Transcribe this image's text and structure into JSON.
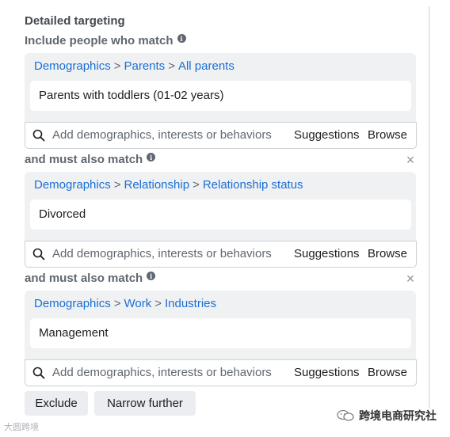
{
  "heading": "Detailed targeting",
  "groups": [
    {
      "label": "Include people who match",
      "crumbs": [
        "Demographics",
        "Parents",
        "All parents"
      ],
      "selected": "Parents with toddlers (01-02 years)"
    },
    {
      "label": "and must also match",
      "crumbs": [
        "Demographics",
        "Relationship",
        "Relationship status"
      ],
      "selected": "Divorced"
    },
    {
      "label": "and must also match",
      "crumbs": [
        "Demographics",
        "Work",
        "Industries"
      ],
      "selected": "Management"
    }
  ],
  "separator": ">",
  "info_glyph": "i",
  "close_glyph": "×",
  "search": {
    "placeholder": "Add demographics, interests or behaviors",
    "suggestions": "Suggestions",
    "browse": "Browse"
  },
  "buttons": {
    "exclude": "Exclude",
    "narrow": "Narrow further"
  },
  "watermarks": {
    "left": "大圆跨境",
    "right": "跨境电商研究社"
  },
  "colors": {
    "link": "#1a6fd4",
    "panel": "#f0f1f3"
  }
}
